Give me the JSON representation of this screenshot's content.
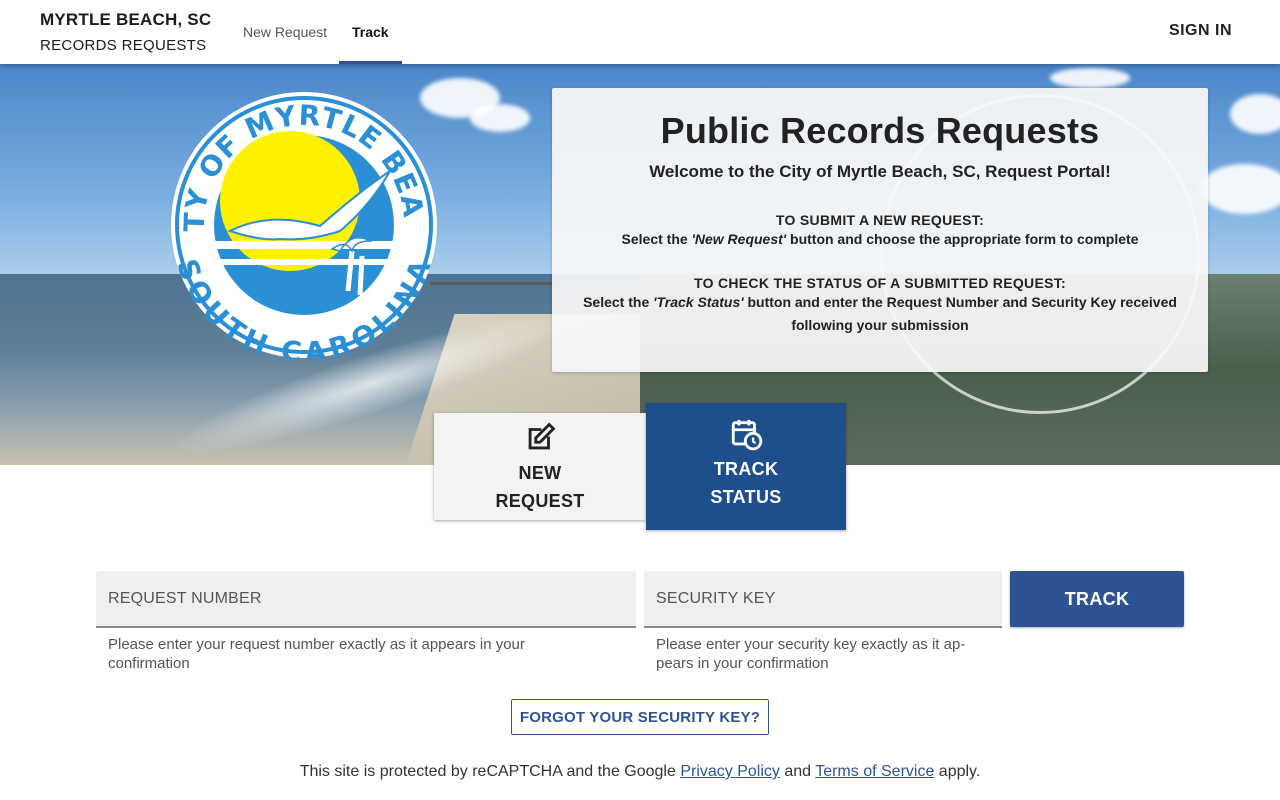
{
  "header": {
    "brand_line1": "MYRTLE BEACH, SC",
    "brand_line2": "RECORDS REQUESTS",
    "nav": [
      {
        "label": "New Request"
      },
      {
        "label": "Track"
      }
    ],
    "sign_in": "SIGN IN"
  },
  "logo": {
    "top_text": "CITY OF MYRTLE BEACH",
    "bottom_text": "SOUTH CAROLINA"
  },
  "info": {
    "title": "Public Records Requests",
    "welcome": "Welcome to the City of Myrtle Beach, SC, Request Portal!",
    "submit_title": "TO SUBMIT A NEW REQUEST:",
    "submit_pre": "Select the ",
    "submit_em": "'New Request'",
    "submit_post": " button and choose the appropriate form to complete",
    "status_title": "TO CHECK THE STATUS OF A SUBMITTED REQUEST:",
    "status_pre": "Select the ",
    "status_em": "'Track Status'",
    "status_post": " button and enter the Request Number and Security Key received following your submission"
  },
  "tiles": {
    "new_line1": "NEW",
    "new_line2": "REQUEST",
    "track_line1": "TRACK",
    "track_line2": "STATUS"
  },
  "form": {
    "request_placeholder": "REQUEST NUMBER",
    "request_hint": "Please enter your request number exactly as it appears in your confirmation",
    "key_placeholder": "SECURITY KEY",
    "key_hint": "Please enter your security key exactly as it ap-pears in your confirmation",
    "track_label": "TRACK",
    "forgot_label": "FORGOT YOUR SECURITY KEY?"
  },
  "recaptcha": {
    "prefix": "This site is protected by reCAPTCHA and the Google ",
    "privacy": "Privacy Policy",
    "and": " and ",
    "terms": "Terms of Service",
    "suffix": " apply."
  },
  "colors": {
    "brand_blue": "#2e5395",
    "tile_blue": "#1f4e8c",
    "logo_yellow": "#fff200",
    "logo_blue": "#2b8fd6"
  }
}
